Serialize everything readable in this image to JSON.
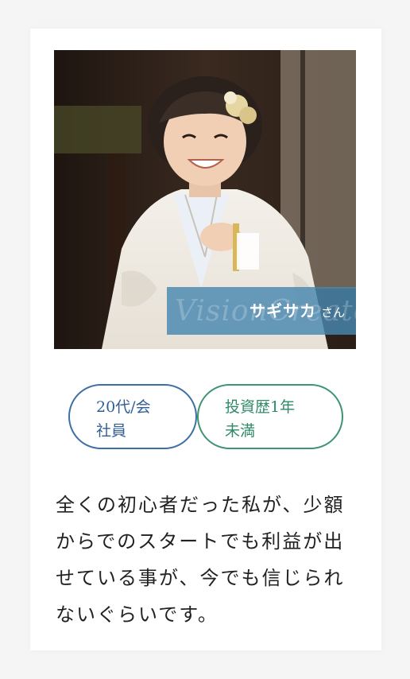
{
  "profile": {
    "name": "サギサカ",
    "honorific": "さん",
    "watermark": "VisionCreator",
    "photo_description_icon": "portrait-photo"
  },
  "tags": [
    {
      "line1": "20代/会",
      "line2": "社員",
      "color": "#3d6ea5"
    },
    {
      "line1": "投資歴1年",
      "line2": "未満",
      "color": "#3c9470"
    }
  ],
  "testimonial": {
    "text": "全くの初心者だった私が、少額からでのスタートでも利益が出せている事が、今でも信じられないぐらいです。"
  }
}
